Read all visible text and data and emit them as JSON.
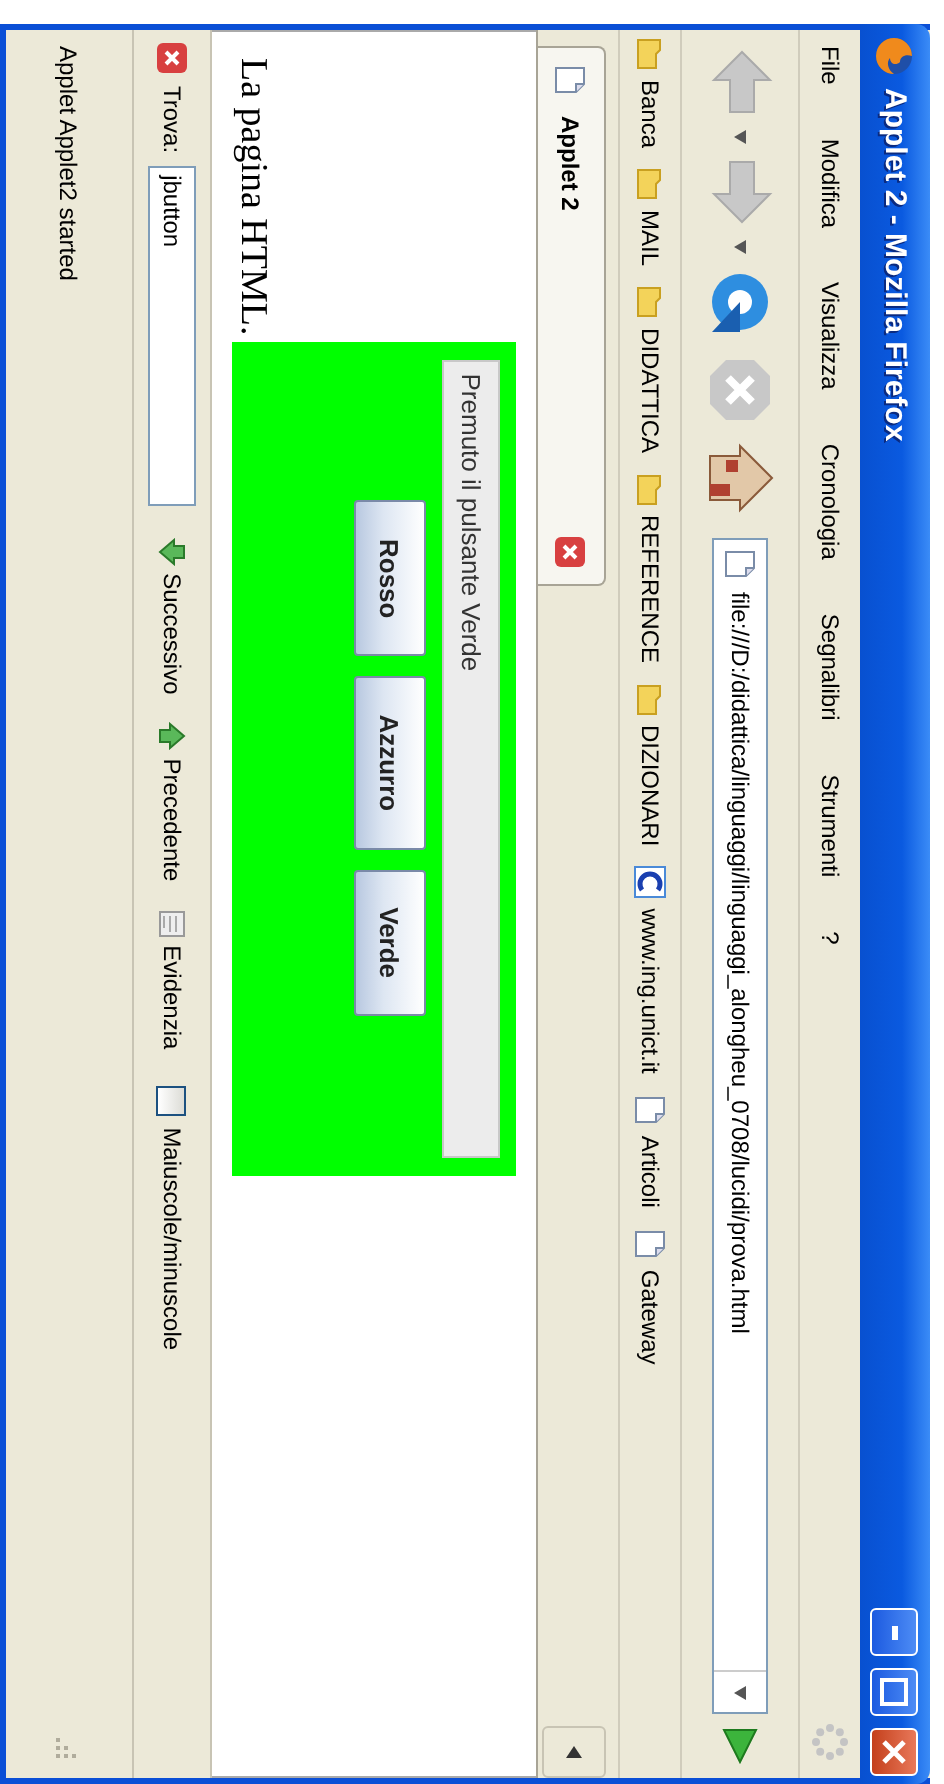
{
  "window": {
    "title": "Applet 2 - Mozilla Firefox"
  },
  "menu": [
    "File",
    "Modifica",
    "Visualizza",
    "Cronologia",
    "Segnalibri",
    "Strumenti",
    "?"
  ],
  "nav_buttons": [
    {
      "kind": "back",
      "disabled": true
    },
    {
      "kind": "forward",
      "disabled": true
    },
    {
      "kind": "reload",
      "disabled": false
    },
    {
      "kind": "stop",
      "disabled": true
    },
    {
      "kind": "home",
      "disabled": false
    }
  ],
  "address": {
    "value": "file:///D:/didattica/linguaggi/linguaggi_alongheu_0708/lucidi/prova.html"
  },
  "bookmarks": [
    {
      "label": "Banca",
      "kind": "folder"
    },
    {
      "label": "MAIL",
      "kind": "folder"
    },
    {
      "label": "DIDATTICA",
      "kind": "folder"
    },
    {
      "label": "REFERENCE",
      "kind": "folder"
    },
    {
      "label": "DIZIONARI",
      "kind": "folder"
    },
    {
      "label": "www.ing.unict.it",
      "kind": "site"
    },
    {
      "label": "Articoli",
      "kind": "page"
    },
    {
      "label": "Gateway",
      "kind": "page"
    }
  ],
  "tabs": [
    {
      "label": "Applet 2",
      "selected": true
    }
  ],
  "page": {
    "text": "La pagina HTML.",
    "applet": {
      "message": "Premuto il pulsante Verde",
      "buttons": [
        "Rosso",
        "Azzurro",
        "Verde"
      ]
    }
  },
  "find_bar": {
    "label": "Trova:",
    "value": "jbutton",
    "buttons": [
      {
        "label": "Successivo",
        "kind": "next"
      },
      {
        "label": "Precedente",
        "kind": "previous"
      },
      {
        "label": "Evidenzia",
        "kind": "highlight"
      }
    ],
    "match_case": {
      "label": "Maiuscole/minuscole",
      "checked": false
    }
  },
  "status_bar": {
    "text": "Applet Applet2 started"
  }
}
